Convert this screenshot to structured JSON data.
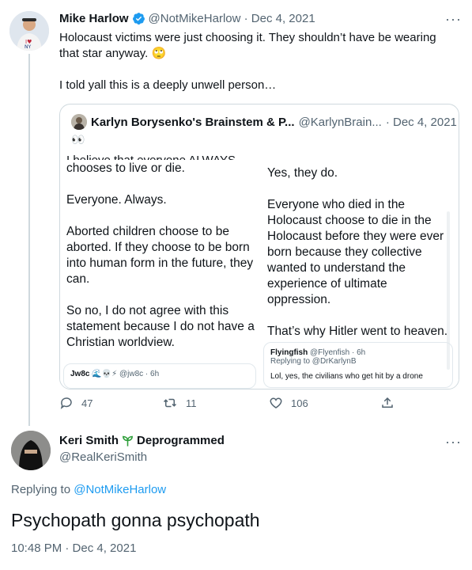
{
  "tweet1": {
    "name": "Mike Harlow",
    "handle_date": "@NotMikeHarlow · Dec 4, 2021",
    "more": "···",
    "text_line1": "Holocaust victims were just choosing it. They shouldn’t have be wearing",
    "text_line2": "that star anyway. 🙄",
    "text_line3": "I told yall this is a deeply unwell person…",
    "quote": {
      "name": "Karlyn Borysenko's Brainstem & P...",
      "handle": "@KarlynBrain...",
      "date": "· Dec 4, 2021",
      "eyes": "👀",
      "cut_text": "I believe that everyone ALWAYS",
      "left_col": [
        "chooses to live or die.",
        "Everyone. Always.",
        "Aborted children choose to be aborted. If they choose to be born into human form in the future, they can.",
        "So no, I do not agree with this statement because I do not have a Christian worldview."
      ],
      "right_col": [
        "Yes, they do.",
        "Everyone who died in the Holocaust choose to die in the Holocaust before they were ever born because they collective wanted to understand the experience of ultimate oppression.",
        "That’s why Hitler went to heaven."
      ],
      "embed_right": {
        "name": "Flyingfish",
        "handle_time": "@Flyenfish · 6h",
        "replying": "Replying to @DrKarlynB",
        "text": "Lol, yes, the civilians who get hit by a drone"
      },
      "embed_left": {
        "name": "Jw8c",
        "emojis": "🌊💀⚡",
        "handle_time": "@jw8c · 6h"
      }
    },
    "actions": {
      "replies": "47",
      "retweets": "11",
      "likes": "106"
    }
  },
  "tweet2": {
    "name": "Keri Smith",
    "badge": "Deprogrammed",
    "handle": "@RealKeriSmith",
    "more": "···",
    "replying_prefix": "Replying to ",
    "replying_handle": "@NotMikeHarlow",
    "text": "Psychopath gonna psychopath",
    "timestamp": "10:48 PM · Dec 4, 2021"
  },
  "colors": {
    "accent": "#1d9bf0",
    "secondary_text": "#536471",
    "border": "#cfd9de"
  }
}
